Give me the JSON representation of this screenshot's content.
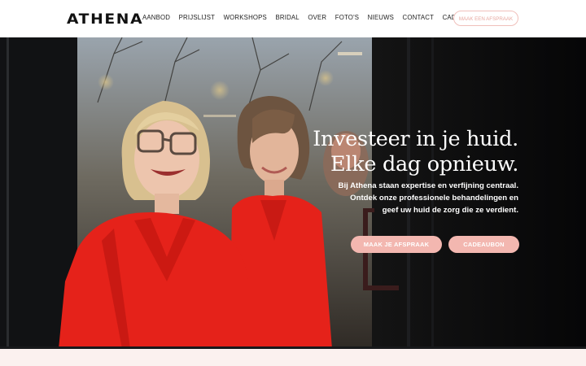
{
  "header": {
    "logo": "ATHENA",
    "nav": [
      "AANBOD",
      "PRIJSLIJST",
      "WORKSHOPS",
      "BRIDAL",
      "OVER",
      "FOTO'S",
      "NIEUWS",
      "CONTACT",
      "CADEAUBON"
    ],
    "cta": "MAAK EEN AFSPRAAK"
  },
  "hero": {
    "title_line1": "Investeer in je huid.",
    "title_line2": "Elke dag opnieuw.",
    "text_line1": "Bij Athena staan expertise en verfijning centraal.",
    "text_line2": "Ontdek onze professionele behandelingen en",
    "text_line3": "geef uw huid de zorg die ze verdient.",
    "btn_appointment": "MAAK JE AFSPRAAK",
    "btn_gift": "CADEAUBON"
  },
  "colors": {
    "accent": "#f3b7b0",
    "jacket": "#e5221a",
    "hero_bg": "#0d0d0f",
    "page_bg": "#fbf1ef"
  }
}
